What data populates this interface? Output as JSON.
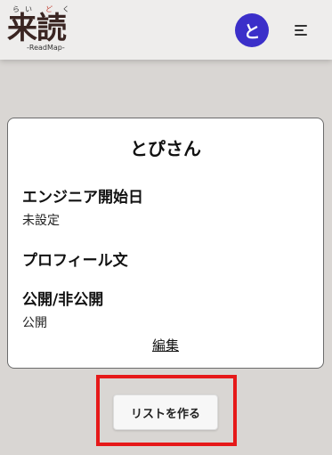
{
  "header": {
    "logo": {
      "main": "来読",
      "ruby": [
        "ら",
        "い",
        "ど",
        "く"
      ],
      "subtitle": "-ReadMap-"
    },
    "avatar_initial": "と",
    "menu_icon": "hamburger-icon"
  },
  "profile": {
    "name": "とぴさん",
    "engineer_start_label": "エンジニア開始日",
    "engineer_start_value": "未設定",
    "bio_label": "プロフィール文",
    "visibility_label": "公開/非公開",
    "visibility_value": "公開",
    "edit_label": "編集"
  },
  "actions": {
    "create_list_label": "リストを作る"
  },
  "colors": {
    "background": "#d9d6d3",
    "header": "#eeedec",
    "avatar": "#3b2fc9",
    "highlight": "#e61919"
  }
}
